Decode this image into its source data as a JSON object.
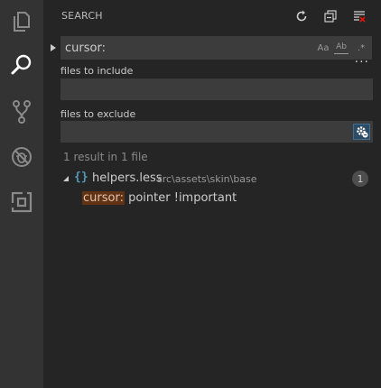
{
  "panel": {
    "title": "SEARCH",
    "actions": [
      {
        "name": "refresh",
        "icon": "refresh-icon"
      },
      {
        "name": "collapse-all",
        "icon": "collapse-all-icon"
      },
      {
        "name": "clear-results",
        "icon": "clear-results-icon"
      }
    ]
  },
  "activity_bar": [
    {
      "name": "explorer",
      "icon": "files-icon",
      "active": false
    },
    {
      "name": "search",
      "icon": "search-icon",
      "active": true
    },
    {
      "name": "source-control",
      "icon": "git-branch-icon",
      "active": false
    },
    {
      "name": "debug",
      "icon": "bug-icon",
      "active": false
    },
    {
      "name": "extensions",
      "icon": "extensions-icon",
      "active": false
    }
  ],
  "search": {
    "value": "cursor:",
    "options": {
      "match_case": "Aa",
      "whole_word": "Ab",
      "regex": ".*"
    }
  },
  "include": {
    "label": "files to include",
    "value": ""
  },
  "exclude": {
    "label": "files to exclude",
    "value": ""
  },
  "results": {
    "summary": "1 result in 1 file",
    "files": [
      {
        "icon": "{}",
        "name": "helpers.less",
        "path": "src\\assets\\skin\\base",
        "count": "1",
        "matches": [
          {
            "highlight": "cursor:",
            "rest": " pointer !important"
          }
        ]
      }
    ]
  },
  "colors": {
    "activity_bar_bg": "#333333",
    "sidebar_bg": "#252526",
    "input_bg": "#3c3c3c",
    "match_highlight": "#613214",
    "less_icon": "#519aba"
  }
}
